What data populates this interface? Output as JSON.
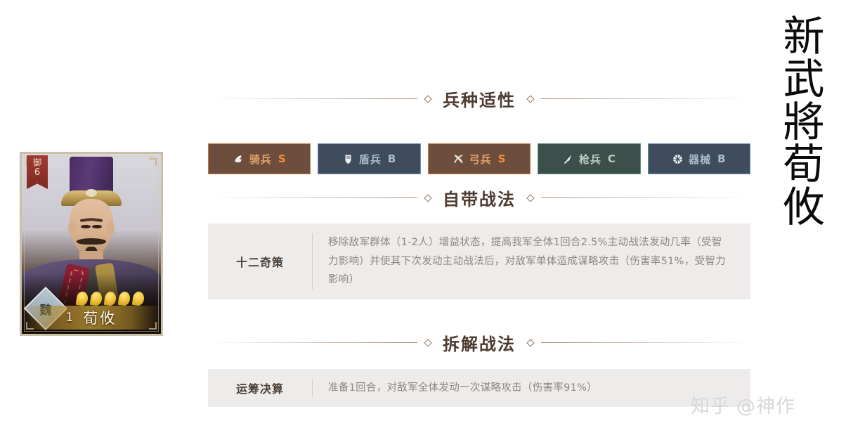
{
  "title_vertical": [
    "新",
    "武",
    "將",
    "荀",
    "攸"
  ],
  "watermark": {
    "site": "知乎",
    "handle": "@神作"
  },
  "hero_card": {
    "rank_badge_label": "御",
    "rank_badge_value": "6",
    "level": "1",
    "name": "荀攸",
    "faction": "魏",
    "star_count": 5
  },
  "sections": {
    "troop": {
      "title": "兵种适性"
    },
    "innate": {
      "title": "自带战法"
    },
    "dismantle": {
      "title": "拆解战法"
    }
  },
  "troop_types": [
    {
      "name": "骑兵",
      "grade": "S",
      "icon": "cavalry-icon",
      "bg": "#6d4d3c",
      "border": "#c4803f",
      "name_color": "#e0a26a",
      "grade_color": "#ef8f3c"
    },
    {
      "name": "盾兵",
      "grade": "B",
      "icon": "shield-icon",
      "bg": "#3f4c5d",
      "border": "#6f93bd",
      "name_color": "#a9bcd2",
      "grade_color": "#a9bcd2"
    },
    {
      "name": "弓兵",
      "grade": "S",
      "icon": "bow-icon",
      "bg": "#6d4d3c",
      "border": "#c4803f",
      "name_color": "#e0a26a",
      "grade_color": "#ef8f3c"
    },
    {
      "name": "枪兵",
      "grade": "C",
      "icon": "spear-icon",
      "bg": "#3b504b",
      "border": "#5f8f7b",
      "name_color": "#b9ccc3",
      "grade_color": "#b9ccc3"
    },
    {
      "name": "器械",
      "grade": "B",
      "icon": "siege-icon",
      "bg": "#3f4c5d",
      "border": "#6f93bd",
      "name_color": "#a9bcd2",
      "grade_color": "#a9bcd2"
    }
  ],
  "innate_tactic": {
    "name": "十二奇策",
    "description": "移除敌军群体（1-2人）增益状态，提高我军全体1回合2.5%主动战法发动几率（受智力影响）并使其下次发动主动战法后，对敌军单体造成谋略攻击（伤害率51%，受智力影响）"
  },
  "dismantle_tactic": {
    "name": "运筹决算",
    "description": "准备1回合，对敌军全体发动一次谋略攻击（伤害率91%）"
  }
}
